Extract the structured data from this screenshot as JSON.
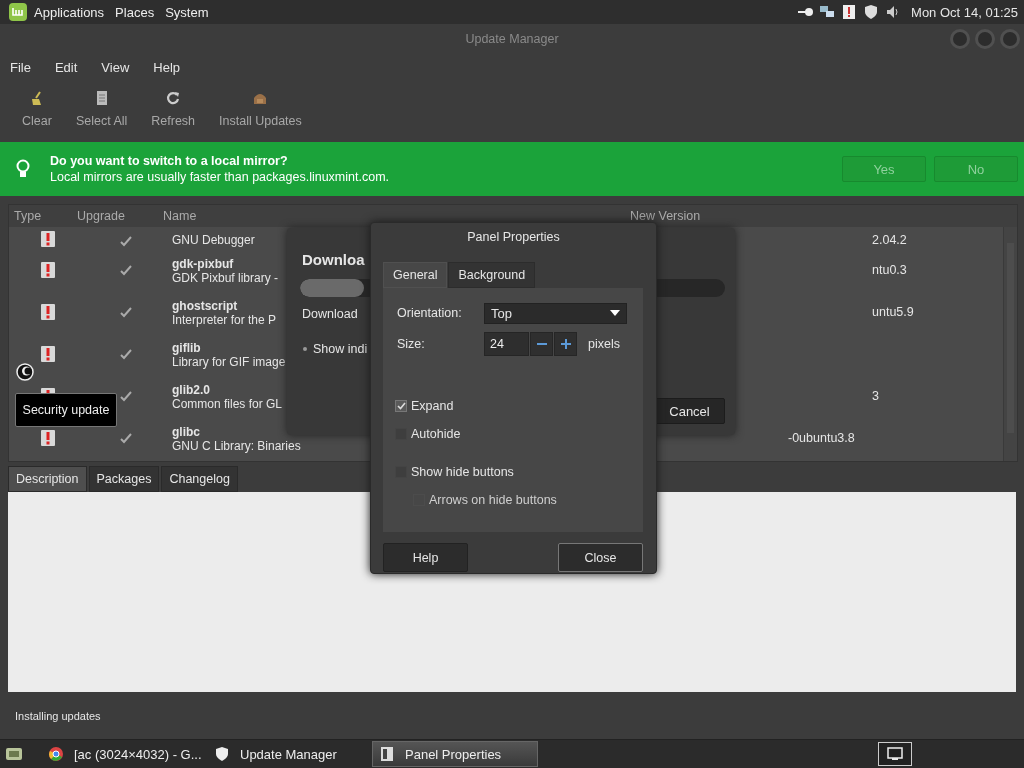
{
  "top_panel": {
    "menus": [
      "Applications",
      "Places",
      "System"
    ],
    "clock": "Mon Oct 14, 01:25"
  },
  "window": {
    "title": "Update Manager"
  },
  "menu_bar": [
    "File",
    "Edit",
    "View",
    "Help"
  ],
  "toolbar": [
    {
      "label": "Clear",
      "kind": "clear"
    },
    {
      "label": "Select All",
      "kind": "select"
    },
    {
      "label": "Refresh",
      "kind": "refresh"
    },
    {
      "label": "Install Updates",
      "kind": "install"
    }
  ],
  "info_bar": {
    "title": "Do you want to switch to a local mirror?",
    "message": "Local mirrors are usually faster than packages.linuxmint.com.",
    "buttons": [
      "Yes",
      "No"
    ]
  },
  "table": {
    "columns": [
      "Type",
      "Upgrade",
      "Name",
      "New Version"
    ],
    "rows": [
      {
        "description": "GNU Debugger",
        "checked": true,
        "new_version": "2.04.2"
      },
      {
        "name": "gdk-pixbuf",
        "description": "GDK Pixbuf library -",
        "checked": true,
        "new_version": "ntu0.3"
      },
      {
        "name": "ghostscript",
        "description": "Interpreter for the P",
        "checked": true,
        "new_version": "untu5.9"
      },
      {
        "name": "giflib",
        "description": "Library for GIF image",
        "checked": true
      },
      {
        "name": "glib2.0",
        "description": "Common files for GL",
        "checked": true,
        "new_version": "3"
      },
      {
        "name": "glibc",
        "description": "GNU C Library: Binaries",
        "checked": true,
        "new_version": "-0ubuntu3.8"
      }
    ]
  },
  "tooltip": "Security update",
  "detail_tabs": [
    {
      "label": "Description",
      "selected": true
    },
    {
      "label": "Packages",
      "selected": false
    },
    {
      "label": "Changelog",
      "selected": false
    }
  ],
  "status_bar": "Installing updates",
  "download_dialog": {
    "title": "Downloa",
    "level": 0.15,
    "text": "Download",
    "option": "Show indi",
    "button": "Cancel"
  },
  "panel_properties": {
    "title": "Panel Properties",
    "tabs": [
      {
        "label": "General",
        "selected": true
      },
      {
        "label": "Background",
        "selected": false
      }
    ],
    "orientation_label": "Orientation:",
    "orientation": "Top",
    "size_label": "Size:",
    "size": "24",
    "size_unit": "pixels",
    "checkboxes": [
      {
        "label": "Expand",
        "checked": true,
        "disabled": false
      },
      {
        "label": "Autohide",
        "checked": false,
        "disabled": false
      },
      {
        "label": "Show hide buttons",
        "checked": false,
        "disabled": false,
        "children": [
          {
            "label": "Arrows on hide buttons",
            "checked": false,
            "disabled": true
          }
        ]
      }
    ],
    "buttons": [
      "Help",
      "Close"
    ]
  },
  "taskbar": [
    {
      "label": "[ac (3024×4032) - G...",
      "kind": "browser",
      "selected": false
    },
    {
      "label": "Update Manager",
      "kind": "shield",
      "selected": false
    },
    {
      "label": "Panel Properties",
      "kind": "window",
      "selected": true
    }
  ]
}
